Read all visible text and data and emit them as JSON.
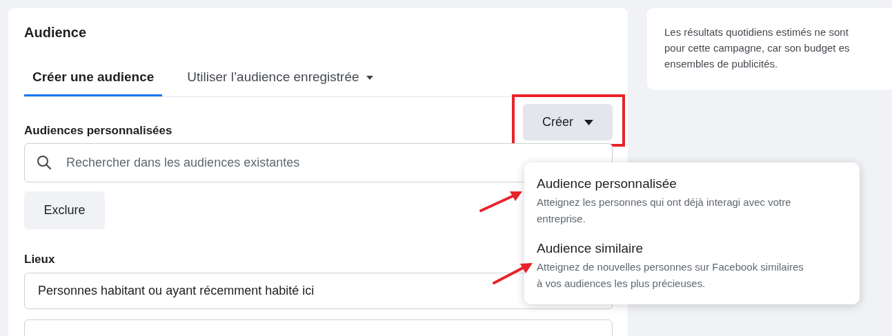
{
  "section_title": "Audience",
  "tabs": [
    {
      "label": "Créer une audience",
      "selected": true,
      "dropdown": false
    },
    {
      "label": "Utiliser l’audience enregistrée",
      "selected": false,
      "dropdown": true
    }
  ],
  "custom_audiences": {
    "label": "Audiences personnalisées",
    "create_button": "Créer",
    "search": {
      "placeholder": "Rechercher dans les audiences existantes"
    },
    "exclude_button": "Exclure"
  },
  "create_menu": [
    {
      "title": "Audience personnalisée",
      "description": "Atteignez les personnes qui ont déjà interagi avec votre entreprise."
    },
    {
      "title": "Audience similaire",
      "description": "Atteignez de nouvelles personnes sur Facebook similaires à vos audiences les plus précieuses."
    }
  ],
  "locations": {
    "label": "Lieux",
    "field_value": "Personnes habitant ou ayant récemment habité ici"
  },
  "info_card": {
    "lines": [
      "Les résultats quotidiens estimés ne sont",
      "pour cette campagne, car son budget es",
      "ensembles de publicités."
    ]
  }
}
